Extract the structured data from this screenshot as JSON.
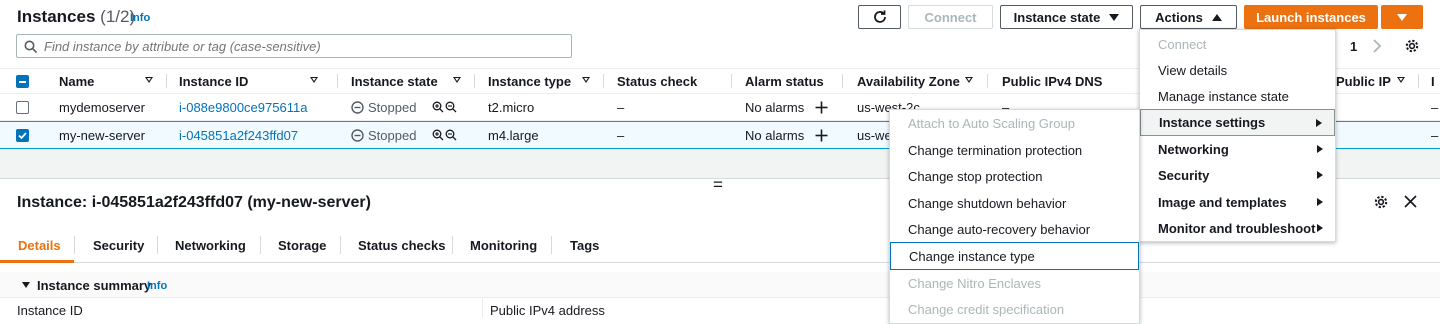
{
  "header": {
    "title": "Instances",
    "count": "(1/2)",
    "info": "Info",
    "connect": "Connect",
    "instance_state": "Instance state",
    "actions": "Actions",
    "launch": "Launch instances"
  },
  "search": {
    "placeholder": "Find instance by attribute or tag (case-sensitive)"
  },
  "pagination": {
    "page": "1"
  },
  "columns": [
    "Name",
    "Instance ID",
    "Instance state",
    "Instance type",
    "Status check",
    "Alarm status",
    "Availability Zone",
    "Public IPv4 DNS",
    "Public IP",
    "I"
  ],
  "rows": [
    {
      "name": "mydemoserver",
      "id": "i-088e9800ce975611a",
      "state": "Stopped",
      "type": "t2.micro",
      "status": "–",
      "alarm": "No alarms",
      "az": "us-west-2c",
      "dns": "–",
      "ip": "–",
      "checked": false
    },
    {
      "name": "my-new-server",
      "id": "i-045851a2f243ffd07",
      "state": "Stopped",
      "type": "m4.large",
      "status": "–",
      "alarm": "No alarms",
      "az": "us-we",
      "dns": "",
      "ip": "–",
      "checked": true
    }
  ],
  "actions_menu": {
    "items": [
      {
        "label": "Connect",
        "disabled": true
      },
      {
        "label": "View details"
      },
      {
        "label": "Manage instance state"
      },
      {
        "label": "Instance settings",
        "submenu": true,
        "active": true
      },
      {
        "label": "Networking",
        "submenu": true
      },
      {
        "label": "Security",
        "submenu": true
      },
      {
        "label": "Image and templates",
        "submenu": true
      },
      {
        "label": "Monitor and troubleshoot",
        "submenu": true
      }
    ]
  },
  "settings_menu": {
    "items": [
      {
        "label": "Attach to Auto Scaling Group",
        "disabled": true
      },
      {
        "label": "Change termination protection"
      },
      {
        "label": "Change stop protection"
      },
      {
        "label": "Change shutdown behavior"
      },
      {
        "label": "Change auto-recovery behavior"
      },
      {
        "label": "Change instance type",
        "highlighted": true
      },
      {
        "label": "Change Nitro Enclaves",
        "disabled": true
      },
      {
        "label": "Change credit specification",
        "disabled": true
      }
    ]
  },
  "detail": {
    "title": "Instance: i-045851a2f243ffd07 (my-new-server)",
    "tabs": [
      "Details",
      "Security",
      "Networking",
      "Storage",
      "Status checks",
      "Monitoring",
      "Tags"
    ],
    "summary_title": "Instance summary",
    "summary_info": "Info",
    "field_instance_id": "Instance ID",
    "field_public_ipv4": "Public IPv4 address"
  },
  "drag_handle": "=",
  "colors": {
    "accent": "#0073bb",
    "primary": "#ec7211",
    "selected_tab": "#ec7211"
  }
}
